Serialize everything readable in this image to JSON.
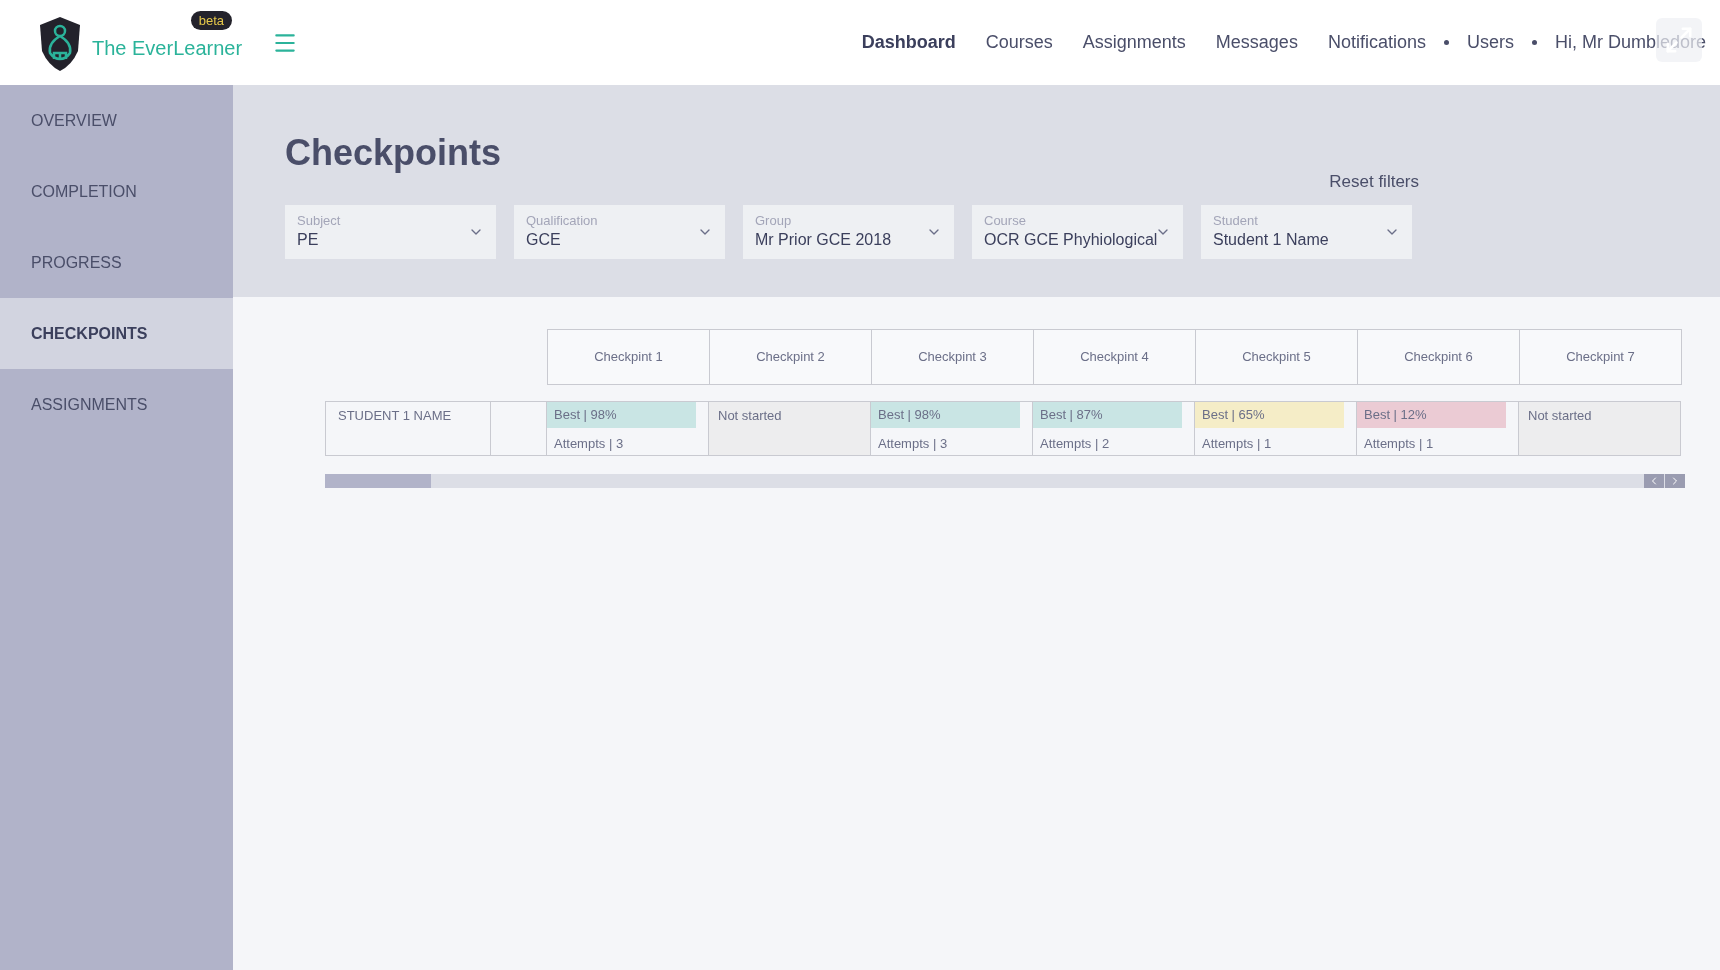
{
  "brand": {
    "name": "The EverLearner",
    "badge": "beta"
  },
  "nav": [
    {
      "label": "Dashboard",
      "selected": true,
      "dot_before": false
    },
    {
      "label": "Courses",
      "selected": false,
      "dot_before": false
    },
    {
      "label": "Assignments",
      "selected": false,
      "dot_before": false
    },
    {
      "label": "Messages",
      "selected": false,
      "dot_before": false
    },
    {
      "label": "Notifications",
      "selected": false,
      "dot_before": false
    },
    {
      "label": "Users",
      "selected": false,
      "dot_before": true
    },
    {
      "label": "Hi, Mr Dumbledore",
      "selected": false,
      "dot_before": true
    }
  ],
  "sidebar": {
    "items": [
      {
        "label": "OVERVIEW",
        "selected": false
      },
      {
        "label": "COMPLETION",
        "selected": false
      },
      {
        "label": "PROGRESS",
        "selected": false
      },
      {
        "label": "CHECKPOINTS",
        "selected": true
      },
      {
        "label": "ASSIGNMENTS",
        "selected": false
      }
    ]
  },
  "page": {
    "title": "Checkpoints",
    "reset": "Reset filters"
  },
  "filters": [
    {
      "label": "Subject",
      "value": "PE"
    },
    {
      "label": "Qualification",
      "value": "GCE"
    },
    {
      "label": "Group",
      "value": "Mr Prior GCE 2018"
    },
    {
      "label": "Course",
      "value": "OCR GCE Phyhiological"
    },
    {
      "label": "Student",
      "value": "Student 1 Name"
    }
  ],
  "table": {
    "columns": [
      "Checkpint 1",
      "Checkpint 2",
      "Checkpint 3",
      "Checkpint 4",
      "Checkpint 5",
      "Checkpint 6",
      "Checkpint 7"
    ],
    "rows": [
      {
        "name": "STUDENT 1 NAME",
        "cells": [
          {
            "kind": "score",
            "best": "Best | 98%",
            "attempts": "Attempts | 3",
            "color": "#c9e5e4"
          },
          {
            "kind": "not_started",
            "text": "Not started"
          },
          {
            "kind": "score",
            "best": "Best | 98%",
            "attempts": "Attempts | 3",
            "color": "#c9e5e4"
          },
          {
            "kind": "score",
            "best": "Best | 87%",
            "attempts": "Attempts | 2",
            "color": "#c9e5e4"
          },
          {
            "kind": "score",
            "best": "Best | 65%",
            "attempts": "Attempts | 1",
            "color": "#f5edc7"
          },
          {
            "kind": "score",
            "best": "Best | 12%",
            "attempts": "Attempts | 1",
            "color": "#ebcbd4"
          },
          {
            "kind": "not_started",
            "text": "Not started"
          }
        ]
      }
    ]
  }
}
